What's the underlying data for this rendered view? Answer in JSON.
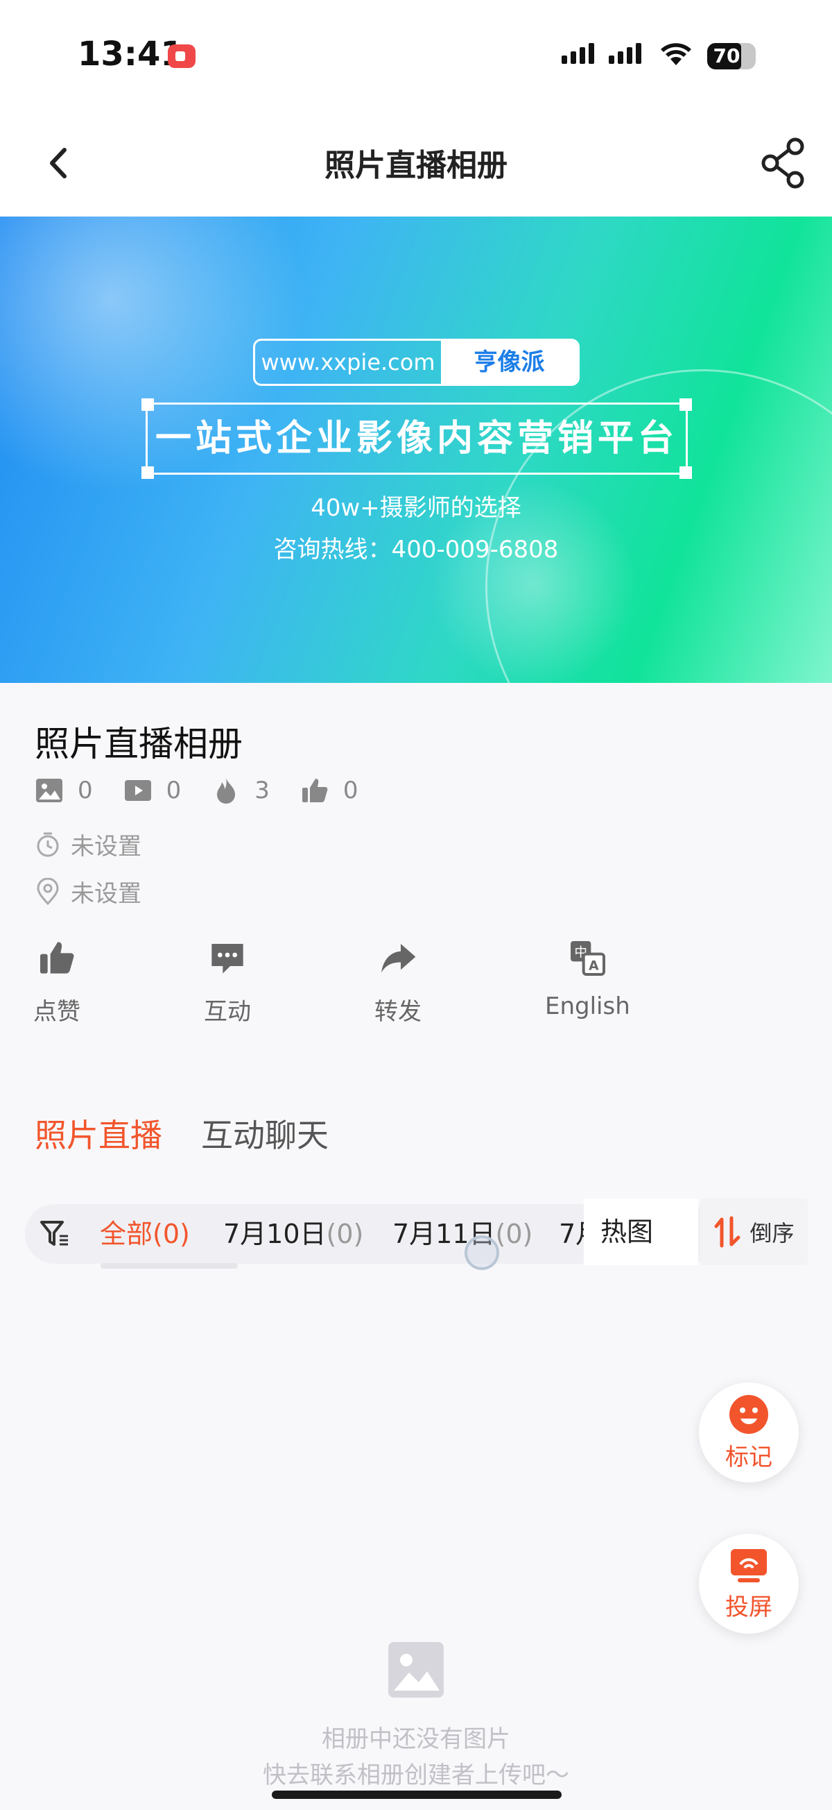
{
  "status_bar": {
    "time": "13:41",
    "battery": "70",
    "battery_level": 0.7
  },
  "nav": {
    "title": "照片直播相册"
  },
  "banner": {
    "url": "www.xxpie.com",
    "brand": "亨像派",
    "slogan": "一站式企业影像内容营销平台",
    "line1": "40w+摄影师的选择",
    "line2": "咨询热线：400-009-6808"
  },
  "album": {
    "title": "照片直播相册",
    "stats": {
      "photos": "0",
      "videos": "0",
      "hot": "3",
      "likes": "0"
    },
    "time": "未设置",
    "location": "未设置"
  },
  "actions": {
    "like": "点赞",
    "interact": "互动",
    "forward": "转发",
    "english": "English"
  },
  "tabs": {
    "live": "照片直播",
    "chat": "互动聊天"
  },
  "filter": {
    "chips": [
      {
        "label": "全部",
        "count": "(0)"
      },
      {
        "label": "7月10日",
        "count": "(0)"
      },
      {
        "label": "7月11日",
        "count": "(0)"
      },
      {
        "label": "7月",
        "count": ""
      }
    ],
    "hot": "热图",
    "order": "倒序"
  },
  "fab": {
    "mark": "标记",
    "cast": "投屏"
  },
  "empty": {
    "line1": "相册中还没有图片",
    "line2": "快去联系相册创建者上传吧～"
  },
  "colors": {
    "accent": "#f2552c",
    "banner_start": "#1e8bf2",
    "banner_end": "#10e39a"
  }
}
